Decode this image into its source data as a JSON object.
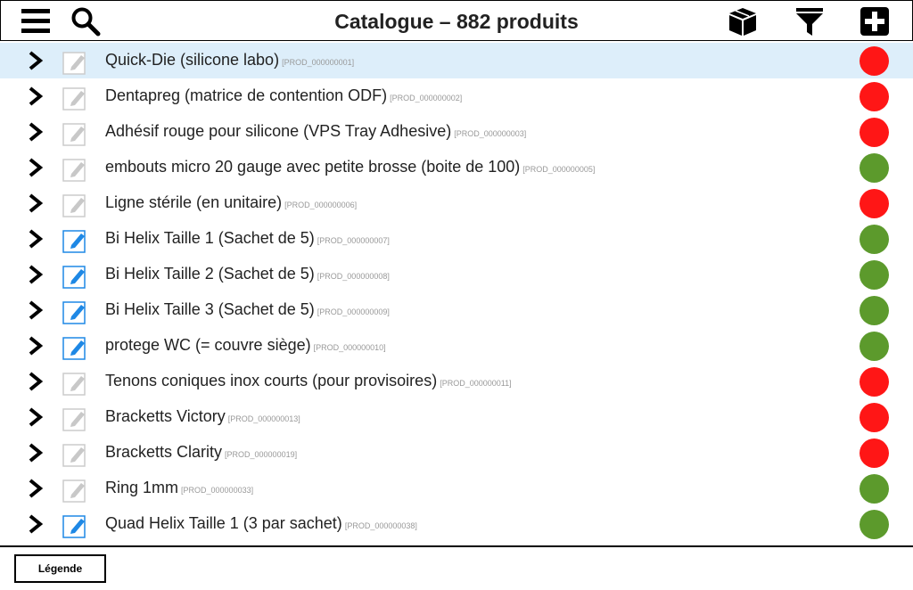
{
  "header": {
    "title": "Catalogue – 882 produits",
    "icons": [
      "menu-icon",
      "search-icon",
      "box-icon",
      "filter-icon",
      "add-icon"
    ]
  },
  "colors": {
    "red": "#ff1616",
    "green": "#5c9a2c",
    "selected_row": "#ddeefa",
    "edit_active": "#1e88e5",
    "edit_inactive": "#cccccc"
  },
  "products": [
    {
      "name": "Quick-Die (silicone labo)",
      "ref": "[PROD_000000001]",
      "status": "red",
      "editable": false,
      "selected": true
    },
    {
      "name": "Dentapreg (matrice de contention ODF)",
      "ref": "[PROD_000000002]",
      "status": "red",
      "editable": false
    },
    {
      "name": "Adhésif rouge pour silicone (VPS Tray Adhesive)",
      "ref": "[PROD_000000003]",
      "status": "red",
      "editable": false
    },
    {
      "name": "embouts micro 20 gauge avec petite brosse (boite de 100)",
      "ref": "[PROD_000000005]",
      "status": "green",
      "editable": false
    },
    {
      "name": "Ligne stérile (en unitaire)",
      "ref": "[PROD_000000006]",
      "status": "red",
      "editable": false
    },
    {
      "name": "Bi Helix Taille 1 (Sachet de 5)",
      "ref": "[PROD_000000007]",
      "status": "green",
      "editable": true
    },
    {
      "name": "Bi Helix Taille 2 (Sachet de 5)",
      "ref": "[PROD_000000008]",
      "status": "green",
      "editable": true
    },
    {
      "name": "Bi Helix Taille 3 (Sachet de 5)",
      "ref": "[PROD_000000009]",
      "status": "green",
      "editable": true
    },
    {
      "name": "protege WC (= couvre siège)",
      "ref": "[PROD_000000010]",
      "status": "green",
      "editable": true
    },
    {
      "name": "Tenons coniques inox courts (pour provisoires)",
      "ref": "[PROD_000000011]",
      "status": "red",
      "editable": false
    },
    {
      "name": "Bracketts Victory",
      "ref": "[PROD_000000013]",
      "status": "red",
      "editable": false
    },
    {
      "name": "Bracketts Clarity",
      "ref": "[PROD_000000019]",
      "status": "red",
      "editable": false
    },
    {
      "name": "Ring 1mm",
      "ref": "[PROD_000000033]",
      "status": "green",
      "editable": false
    },
    {
      "name": "Quad Helix Taille 1 (3 par sachet)",
      "ref": "[PROD_000000038]",
      "status": "green",
      "editable": true
    }
  ],
  "footer": {
    "legend_label": "Légende"
  }
}
